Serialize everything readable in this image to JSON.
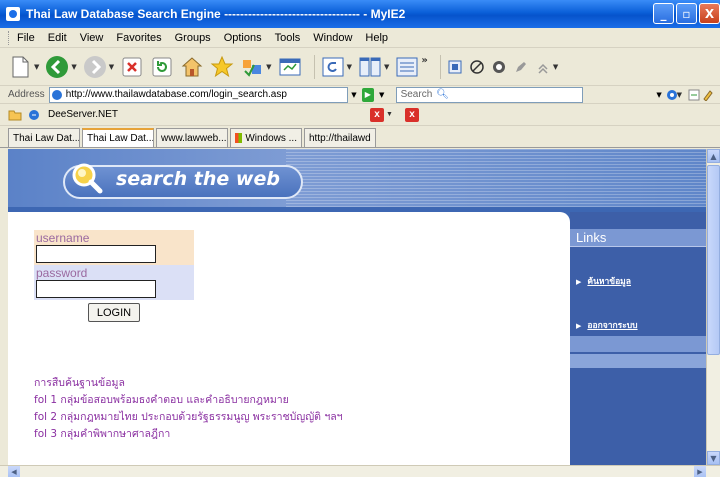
{
  "window": {
    "title": "Thai Law Database Search Engine ---------------------------------- - MyIE2",
    "minimize": "_",
    "maximize": "▫",
    "close": "X"
  },
  "menu": [
    "File",
    "Edit",
    "View",
    "Favorites",
    "Groups",
    "Options",
    "Tools",
    "Window",
    "Help"
  ],
  "address": {
    "label": "Address",
    "url": "http://www.thailawdatabase.com/login_search.asp"
  },
  "search": {
    "label": "Search"
  },
  "links_bar": {
    "label": "DeeServer.NET"
  },
  "tabs": [
    {
      "label": "Thai Law Dat...",
      "active": false
    },
    {
      "label": "Thai Law Dat...",
      "active": true
    },
    {
      "label": "www.lawweb...",
      "active": false
    },
    {
      "label": "Windows ...",
      "active": false
    },
    {
      "label": "http://thailawd",
      "active": false
    }
  ],
  "page": {
    "banner_text": "search the web",
    "username_label": "username",
    "password_label": "password",
    "login_label": "LOGIN",
    "thai_lines": [
      "การสืบค้นฐานข้อมูล",
      "fol 1 กลุ่มข้อสอบพร้อมธงคำตอบ และคำอธิบายกฎหมาย",
      "fol 2 กลุ่มกฎหมายไทย ประกอบด้วยรัฐธรรมนูญ พระราชบัญญัติ ฯลฯ",
      "fol 3 กลุ่มคำพิพากษาศาลฎีกา"
    ],
    "sidebar": {
      "header": "Links",
      "items": [
        "ค้นหาข้อมูล",
        "ออกจากระบบ"
      ]
    }
  }
}
